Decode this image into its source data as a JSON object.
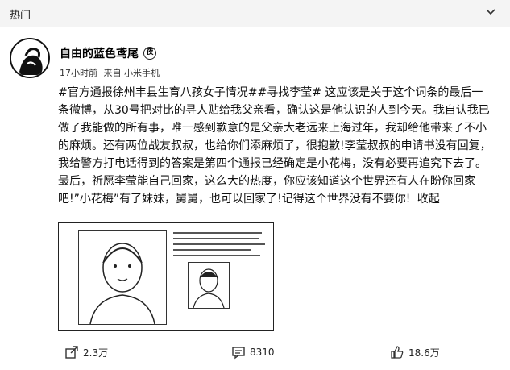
{
  "topbar": {
    "title": "热门"
  },
  "post": {
    "author_name": "自由的蓝色鸢尾",
    "badge": "夜",
    "time": "17小时前",
    "source": "来自 小米手机",
    "text": "#官方通报徐州丰县生育八孩女子情况##寻找李莹# 这应该是关于这个词条的最后一条微博，从30号把对比的寻人贴给我父亲看，确认这是他认识的人到今天。我自认我已做了我能做的所有事，唯一感到歉意的是父亲大老远来上海过年，我却给他带来了不小的麻烦。还有两位战友叔叔，也给你们添麻烦了，很抱歉!李莹叔叔的申请书没有回复，我给警方打电话得到的答案是第四个通报已经确定是小花梅，没有必要再追究下去了。最后，祈愿李莹能自己回家，这么大的热度，你应该知道这个世界还有人在盼你回家吧!”小花梅”有了妹妹，舅舅，也可以回家了!记得这个世界没有不要你!",
    "more": "收起"
  },
  "actions": {
    "share_count": "2.3万",
    "comment_count": "8310",
    "like_count": "18.6万"
  }
}
